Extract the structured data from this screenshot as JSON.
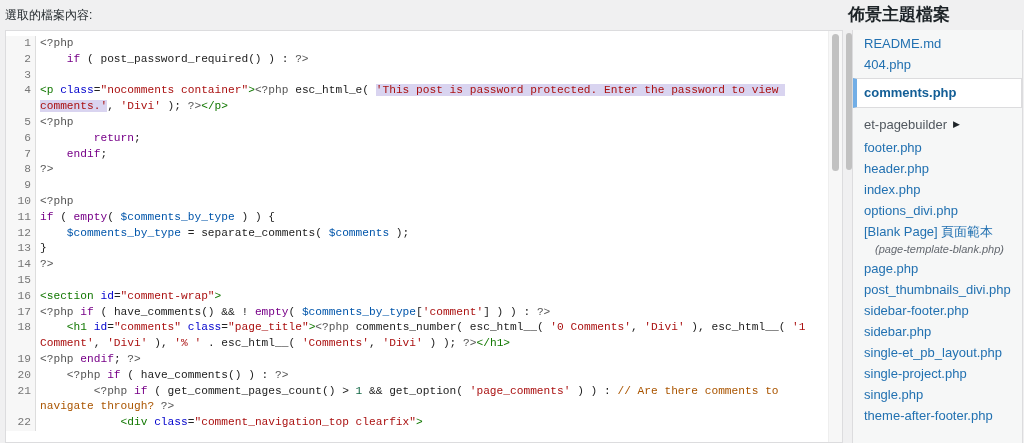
{
  "editor": {
    "label": "選取的檔案內容:",
    "lines": [
      {
        "number": "1",
        "segments": [
          {
            "kind": "meta",
            "text": "<?php"
          }
        ]
      },
      {
        "number": "2",
        "segments": [
          {
            "kind": "keyword",
            "text": "    if"
          },
          {
            "kind": "plain",
            "text": " ( post_password_required() ) : "
          },
          {
            "kind": "meta",
            "text": "?>"
          }
        ]
      },
      {
        "number": "3"
      },
      {
        "number": "4",
        "segments": [
          {
            "kind": "tag",
            "text": "<p"
          },
          {
            "kind": "attr",
            "text": " class"
          },
          {
            "kind": "plain",
            "text": "="
          },
          {
            "kind": "string",
            "text": "\"nocomments container\""
          },
          {
            "kind": "tag",
            "text": ">"
          },
          {
            "kind": "meta",
            "text": "<?php"
          },
          {
            "kind": "plain",
            "text": " esc_html_e( "
          },
          {
            "kind": "selection",
            "text": "'This post is password protected. Enter the password to view comments.'"
          },
          {
            "kind": "plain",
            "text": ", "
          },
          {
            "kind": "string",
            "text": "'Divi'"
          },
          {
            "kind": "plain",
            "text": " ); "
          },
          {
            "kind": "meta",
            "text": "?>"
          },
          {
            "kind": "tag",
            "text": "</p>"
          }
        ]
      },
      {
        "number": "5",
        "segments": [
          {
            "kind": "meta",
            "text": "<?php"
          }
        ]
      },
      {
        "number": "6",
        "segments": [
          {
            "kind": "keyword",
            "text": "        return"
          },
          {
            "kind": "plain",
            "text": ";"
          }
        ]
      },
      {
        "number": "7",
        "segments": [
          {
            "kind": "keyword",
            "text": "    endif"
          },
          {
            "kind": "plain",
            "text": ";"
          }
        ]
      },
      {
        "number": "8",
        "segments": [
          {
            "kind": "meta",
            "text": "?>"
          }
        ]
      },
      {
        "number": "9"
      },
      {
        "number": "10",
        "segments": [
          {
            "kind": "meta",
            "text": "<?php"
          }
        ]
      },
      {
        "number": "11",
        "segments": [
          {
            "kind": "keyword",
            "text": "if"
          },
          {
            "kind": "plain",
            "text": " ( "
          },
          {
            "kind": "keyword",
            "text": "empty"
          },
          {
            "kind": "plain",
            "text": "( "
          },
          {
            "kind": "variable",
            "text": "$comments_by_type"
          },
          {
            "kind": "plain",
            "text": " ) ) {"
          }
        ]
      },
      {
        "number": "12",
        "segments": [
          {
            "kind": "variable",
            "text": "    $comments_by_type"
          },
          {
            "kind": "plain",
            "text": " = separate_comments( "
          },
          {
            "kind": "variable",
            "text": "$comments"
          },
          {
            "kind": "plain",
            "text": " );"
          }
        ]
      },
      {
        "number": "13",
        "segments": [
          {
            "kind": "plain",
            "text": "}"
          }
        ]
      },
      {
        "number": "14",
        "segments": [
          {
            "kind": "meta",
            "text": "?>"
          }
        ]
      },
      {
        "number": "15"
      },
      {
        "number": "16",
        "segments": [
          {
            "kind": "tag",
            "text": "<section"
          },
          {
            "kind": "attr",
            "text": " id"
          },
          {
            "kind": "plain",
            "text": "="
          },
          {
            "kind": "string",
            "text": "\"comment-wrap\""
          },
          {
            "kind": "tag",
            "text": ">"
          }
        ]
      },
      {
        "number": "17",
        "segments": [
          {
            "kind": "meta",
            "text": "<?php"
          },
          {
            "kind": "keyword",
            "text": " if"
          },
          {
            "kind": "plain",
            "text": " ( have_comments() && ! "
          },
          {
            "kind": "keyword",
            "text": "empty"
          },
          {
            "kind": "plain",
            "text": "( "
          },
          {
            "kind": "variable",
            "text": "$comments_by_type"
          },
          {
            "kind": "plain",
            "text": "["
          },
          {
            "kind": "string",
            "text": "'comment'"
          },
          {
            "kind": "plain",
            "text": "] ) ) : "
          },
          {
            "kind": "meta",
            "text": "?>"
          }
        ]
      },
      {
        "number": "18",
        "segments": [
          {
            "kind": "tag",
            "text": "    <h1"
          },
          {
            "kind": "attr",
            "text": " id"
          },
          {
            "kind": "plain",
            "text": "="
          },
          {
            "kind": "string",
            "text": "\"comments\""
          },
          {
            "kind": "attr",
            "text": " class"
          },
          {
            "kind": "plain",
            "text": "="
          },
          {
            "kind": "string",
            "text": "\"page_title\""
          },
          {
            "kind": "tag",
            "text": ">"
          },
          {
            "kind": "meta",
            "text": "<?php"
          },
          {
            "kind": "plain",
            "text": " comments_number( esc_html__( "
          },
          {
            "kind": "string",
            "text": "'0 Comments'"
          },
          {
            "kind": "plain",
            "text": ", "
          },
          {
            "kind": "string",
            "text": "'Divi'"
          },
          {
            "kind": "plain",
            "text": " ), esc_html__( "
          },
          {
            "kind": "string",
            "text": "'1 Comment'"
          },
          {
            "kind": "plain",
            "text": ", "
          },
          {
            "kind": "string",
            "text": "'Divi'"
          },
          {
            "kind": "plain",
            "text": " ), "
          },
          {
            "kind": "string",
            "text": "'% '"
          },
          {
            "kind": "plain",
            "text": " . esc_html__( "
          },
          {
            "kind": "string",
            "text": "'Comments'"
          },
          {
            "kind": "plain",
            "text": ", "
          },
          {
            "kind": "string",
            "text": "'Divi'"
          },
          {
            "kind": "plain",
            "text": " ) ); "
          },
          {
            "kind": "meta",
            "text": "?>"
          },
          {
            "kind": "tag",
            "text": "</h1>"
          }
        ]
      },
      {
        "number": "19",
        "segments": [
          {
            "kind": "meta",
            "text": "<?php"
          },
          {
            "kind": "keyword",
            "text": " endif"
          },
          {
            "kind": "plain",
            "text": "; "
          },
          {
            "kind": "meta",
            "text": "?>"
          }
        ]
      },
      {
        "number": "20",
        "segments": [
          {
            "kind": "meta",
            "text": "    <?php"
          },
          {
            "kind": "keyword",
            "text": " if"
          },
          {
            "kind": "plain",
            "text": " ( have_comments() ) : "
          },
          {
            "kind": "meta",
            "text": "?>"
          }
        ]
      },
      {
        "number": "21",
        "segments": [
          {
            "kind": "meta",
            "text": "        <?php"
          },
          {
            "kind": "keyword",
            "text": " if"
          },
          {
            "kind": "plain",
            "text": " ( get_comment_pages_count() > "
          },
          {
            "kind": "number",
            "text": "1"
          },
          {
            "kind": "plain",
            "text": " && get_option( "
          },
          {
            "kind": "string",
            "text": "'page_comments'"
          },
          {
            "kind": "plain",
            "text": " ) ) : "
          },
          {
            "kind": "comment",
            "text": "// Are there comments to navigate through?"
          },
          {
            "kind": "meta",
            "text": " ?>"
          }
        ]
      },
      {
        "number": "22",
        "segments": [
          {
            "kind": "tag",
            "text": "            <div"
          },
          {
            "kind": "attr",
            "text": " class"
          },
          {
            "kind": "plain",
            "text": "="
          },
          {
            "kind": "string",
            "text": "\"comment_navigation_top clearfix\""
          },
          {
            "kind": "tag",
            "text": ">"
          }
        ]
      }
    ]
  },
  "sidebar": {
    "title": "佈景主題檔案",
    "items": [
      {
        "kind": "file",
        "label": "README.md",
        "selected": false
      },
      {
        "kind": "file",
        "label": "404.php",
        "selected": false
      },
      {
        "kind": "file",
        "label": "comments.php",
        "selected": true
      },
      {
        "kind": "folder",
        "label": "et-pagebuilder",
        "arrow": "▶",
        "selected": false
      },
      {
        "kind": "file",
        "label": "footer.php",
        "selected": false
      },
      {
        "kind": "file",
        "label": "header.php",
        "selected": false
      },
      {
        "kind": "file",
        "label": "index.php",
        "selected": false
      },
      {
        "kind": "file",
        "label": "options_divi.php",
        "selected": false
      },
      {
        "kind": "template",
        "label": "[Blank Page] 頁面範本",
        "filename": "(page-template-blank.php)",
        "selected": false
      },
      {
        "kind": "file",
        "label": "page.php",
        "selected": false
      },
      {
        "kind": "file",
        "label": "post_thumbnails_divi.php",
        "selected": false
      },
      {
        "kind": "file",
        "label": "sidebar-footer.php",
        "selected": false
      },
      {
        "kind": "file",
        "label": "sidebar.php",
        "selected": false
      },
      {
        "kind": "file",
        "label": "single-et_pb_layout.php",
        "selected": false
      },
      {
        "kind": "file",
        "label": "single-project.php",
        "selected": false
      },
      {
        "kind": "file",
        "label": "single.php",
        "selected": false
      },
      {
        "kind": "file",
        "label": "theme-after-footer.php",
        "selected": false
      }
    ]
  }
}
